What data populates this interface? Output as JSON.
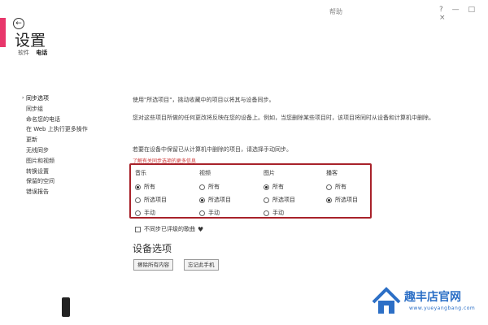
{
  "window": {
    "title": "帮助",
    "controls": [
      "?",
      "—",
      "□",
      "×"
    ]
  },
  "back": {
    "icon": "back-arrow-icon",
    "glyph": "←"
  },
  "page": {
    "title": "设置"
  },
  "subnav": {
    "items": [
      "软件",
      "电话"
    ],
    "active": "电话"
  },
  "sidebar": {
    "selected": "同步选项",
    "items": [
      "同步选项",
      "同步组",
      "命名您的电话",
      "在 Web 上执行更多操作",
      "更新",
      "无线同步",
      "图片和视频",
      "转换设置",
      "保留的空间",
      "错误报告"
    ]
  },
  "main": {
    "intro": "使用\"所选项目\"，挑动收藏中的项目以将其与设备同步。",
    "para1": "您对这些项目所做的任何更改将反映在您的设备上。例如，当您删除某些项目时，该项目将同时从设备和计算机中删除。",
    "para2": "若要在设备中保留已从计算机中删除的项目，请选择手动同步。",
    "red_note": "了解有关同步选项的更多信息"
  },
  "sync_columns": [
    {
      "header": "音乐",
      "options": [
        "所有",
        "所选项目",
        "手动"
      ],
      "selected": "所有"
    },
    {
      "header": "视频",
      "options": [
        "所有",
        "所选项目",
        "手动"
      ],
      "selected": "所选项目"
    },
    {
      "header": "图片",
      "options": [
        "所有",
        "所选项目",
        "手动"
      ],
      "selected": "所有"
    },
    {
      "header": "播客",
      "options": [
        "所有",
        "所选项目"
      ],
      "selected": "所选项目"
    }
  ],
  "checkbox": {
    "label": "不同步已评级的歌曲",
    "checked": false,
    "icon": "heart-broken-icon"
  },
  "device_options": {
    "title": "设备选项",
    "buttons": [
      "擦除所有内容",
      "忘记此手机"
    ]
  },
  "watermark": {
    "text": "趣丰店官网",
    "url": "www.yueyangbang.com"
  },
  "colors": {
    "accent": "#e8366b",
    "highlight_border": "#a8222a",
    "watermark": "#2c6fc6"
  }
}
